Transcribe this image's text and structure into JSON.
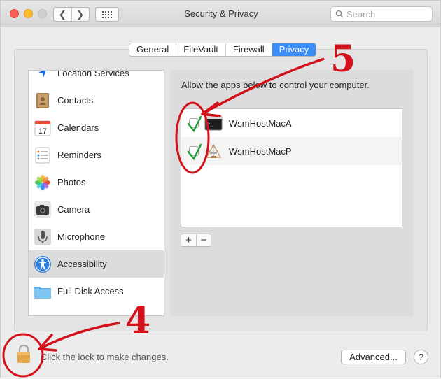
{
  "window": {
    "title": "Security & Privacy",
    "search_placeholder": "Search",
    "nav_back": "❮",
    "nav_forward": "❯"
  },
  "tabs": [
    {
      "label": "General",
      "active": false
    },
    {
      "label": "FileVault",
      "active": false
    },
    {
      "label": "Firewall",
      "active": false
    },
    {
      "label": "Privacy",
      "active": true
    }
  ],
  "sidebar": {
    "items": [
      {
        "label": "Location Services",
        "icon": "location-icon"
      },
      {
        "label": "Contacts",
        "icon": "contacts-icon"
      },
      {
        "label": "Calendars",
        "icon": "calendar-icon",
        "icon_text": "17"
      },
      {
        "label": "Reminders",
        "icon": "reminders-icon"
      },
      {
        "label": "Photos",
        "icon": "photos-icon"
      },
      {
        "label": "Camera",
        "icon": "camera-icon"
      },
      {
        "label": "Microphone",
        "icon": "microphone-icon"
      },
      {
        "label": "Accessibility",
        "icon": "accessibility-icon",
        "selected": true
      },
      {
        "label": "Full Disk Access",
        "icon": "folder-icon"
      }
    ]
  },
  "privacy": {
    "description": "Allow the apps below to control your computer.",
    "apps": [
      {
        "name": "WsmHostMacA",
        "checked": true,
        "icon": "terminal-icon"
      },
      {
        "name": "WsmHostMacP",
        "checked": true,
        "icon": "app-installer-icon"
      }
    ],
    "add_label": "+",
    "remove_label": "−"
  },
  "footer": {
    "lock_text": "Click the lock to make changes.",
    "advanced_label": "Advanced...",
    "help_label": "?"
  },
  "annotations": {
    "step_a": "5",
    "step_b": "4",
    "color": "#d4111b"
  }
}
